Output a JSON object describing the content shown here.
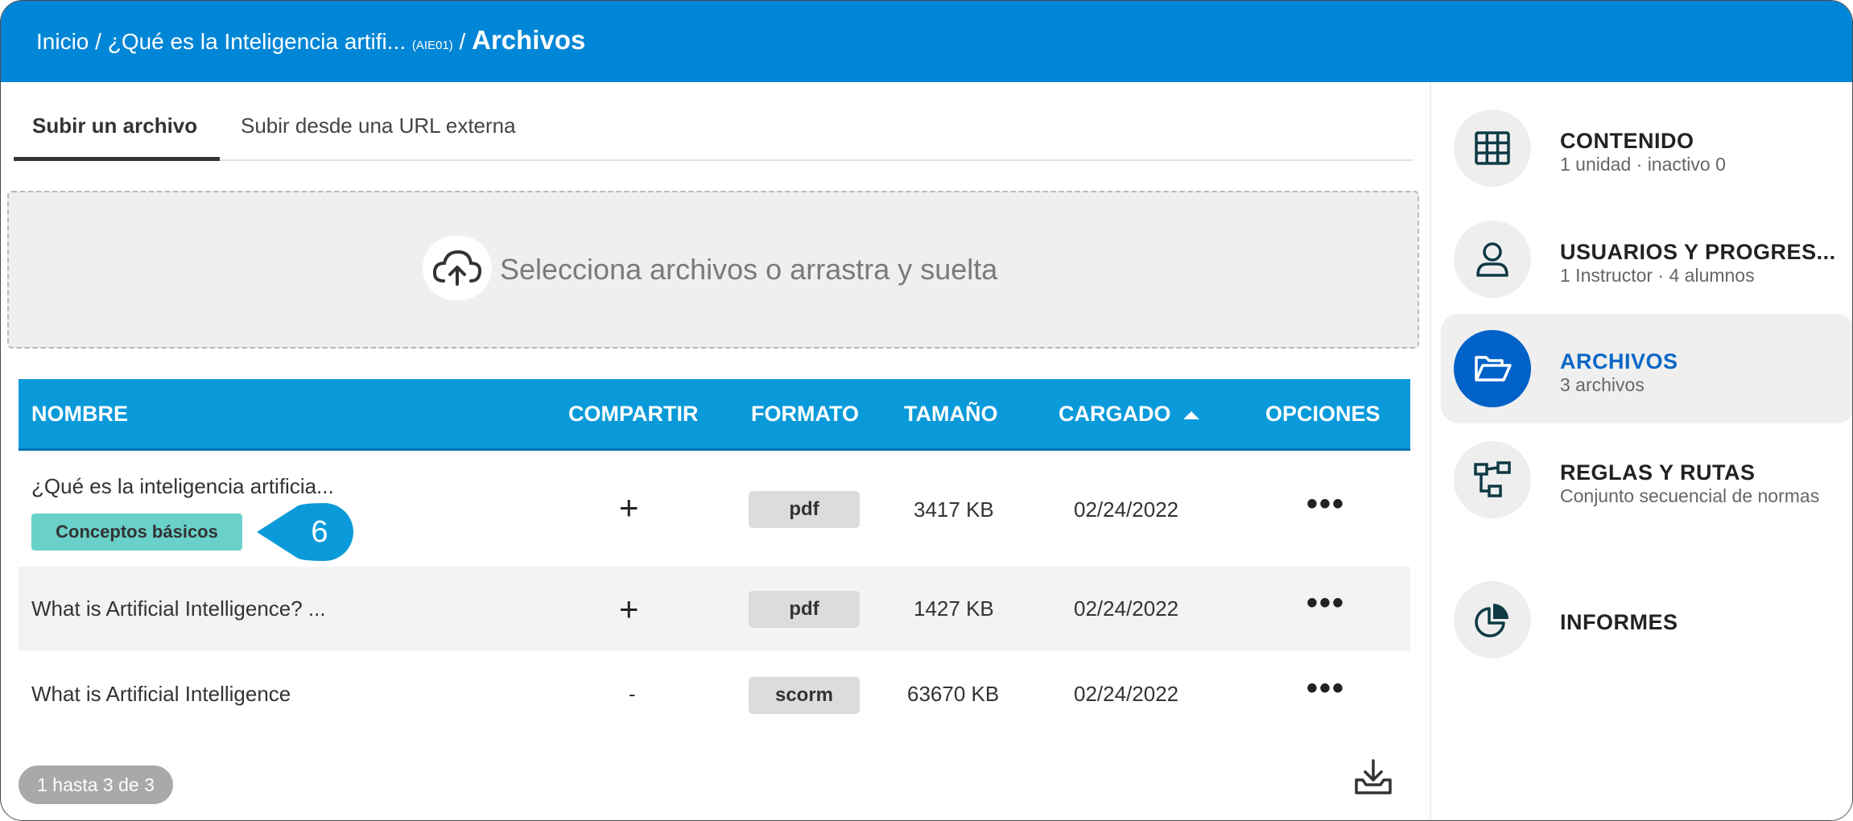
{
  "breadcrumb": {
    "home": "Inicio",
    "separator": "/",
    "course": "¿Qué es la Inteligencia artifi...",
    "course_code": "(AIE01)",
    "current": "Archivos"
  },
  "tabs": {
    "upload": "Subir un archivo",
    "url": "Subir desde una URL externa"
  },
  "dropzone": {
    "icon": "cloud-upload-icon",
    "text": "Selecciona archivos o arrastra y suelta"
  },
  "table": {
    "headers": {
      "name": "NOMBRE",
      "share": "COMPARTIR",
      "format": "FORMATO",
      "size": "TAMAÑO",
      "uploaded": "CARGADO",
      "options": "OPCIONES"
    },
    "sort": {
      "column": "uploaded",
      "direction": "asc"
    },
    "rows": [
      {
        "name": "¿Qué es la inteligencia artificia...",
        "tag": "Conceptos básicos",
        "share": "+",
        "format": "pdf",
        "size": "3417 KB",
        "uploaded": "02/24/2022"
      },
      {
        "name": "What is Artificial Intelligence? ...",
        "share": "+",
        "format": "pdf",
        "size": "1427 KB",
        "uploaded": "02/24/2022"
      },
      {
        "name": "What is Artificial Intelligence",
        "share": "-",
        "format": "scorm",
        "size": "63670 KB",
        "uploaded": "02/24/2022"
      }
    ]
  },
  "callout": {
    "number": "6"
  },
  "pager": {
    "text": "1 hasta 3 de 3"
  },
  "sidebar": {
    "items": [
      {
        "title": "CONTENIDO",
        "sub": "1 unidad · inactivo 0",
        "icon": "grid-icon"
      },
      {
        "title": "USUARIOS Y PROGRES...",
        "sub": "1 Instructor · 4 alumnos",
        "icon": "user-icon"
      },
      {
        "title": "ARCHIVOS",
        "sub": "3 archivos",
        "icon": "folder-open-icon",
        "active": true
      },
      {
        "title": "REGLAS Y RUTAS",
        "sub": "Conjunto secuencial de normas",
        "icon": "flow-icon"
      },
      {
        "title": "INFORMES",
        "sub": "",
        "icon": "pie-chart-icon"
      }
    ]
  },
  "colors": {
    "header": "#0086d6",
    "table_header": "#0a9ada",
    "tag": "#6ad0ca",
    "active_icon": "#0062c8",
    "callout": "#0a9ada"
  }
}
